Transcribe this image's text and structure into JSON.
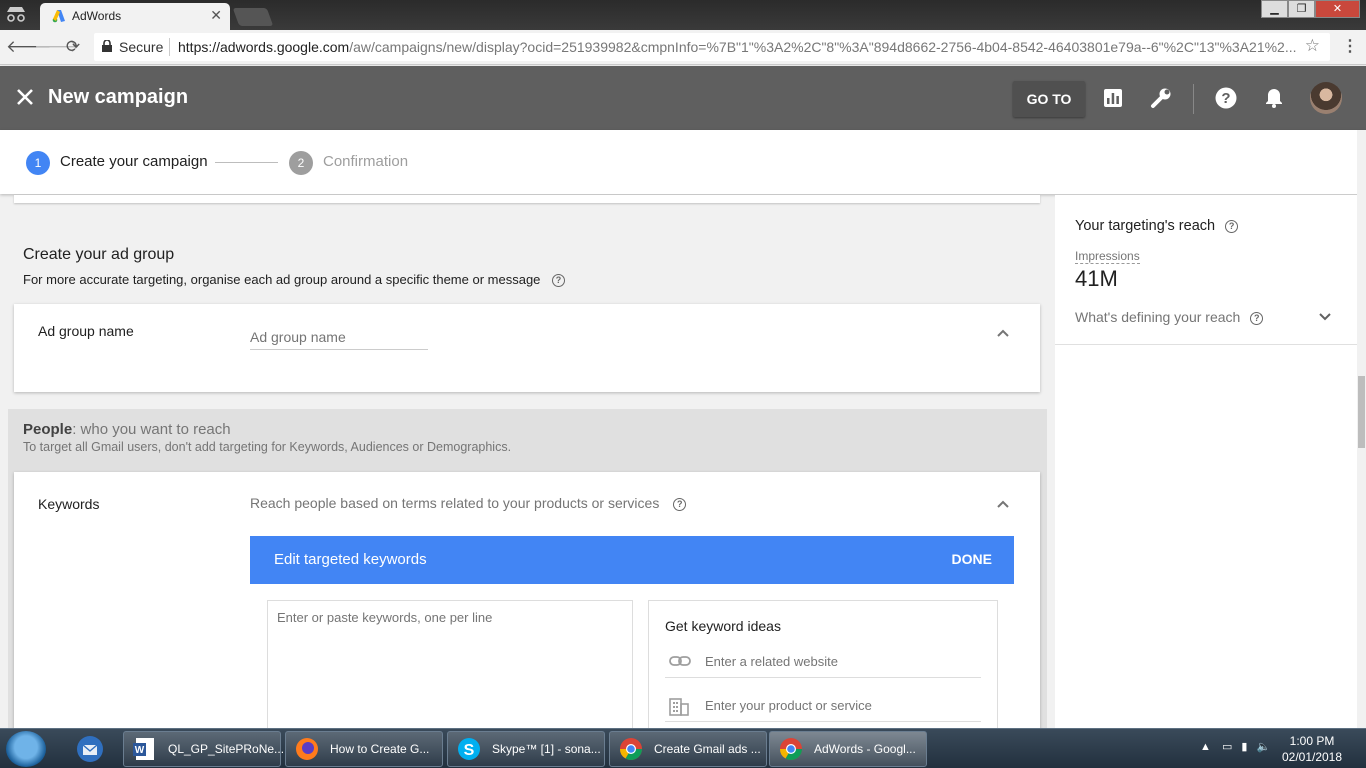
{
  "browser": {
    "tab_title": "AdWords",
    "secure_label": "Secure",
    "url_host": "https://adwords.google.com",
    "url_path": "/aw/campaigns/new/display?ocid=251939982&cmpnInfo=%7B\"1\"%3A2%2C\"8\"%3A\"894d8662-2756-4b04-8542-46403801e79a--6\"%2C\"13\"%3A21%2..."
  },
  "header": {
    "title": "New campaign",
    "goto_label": "GO TO"
  },
  "stepper": {
    "steps": [
      {
        "num": "1",
        "label": "Create your campaign"
      },
      {
        "num": "2",
        "label": "Confirmation"
      }
    ]
  },
  "ad_group": {
    "heading": "Create your ad group",
    "subtext": "For more accurate targeting, organise each ad group around a specific theme or message",
    "name_label": "Ad group name",
    "name_placeholder": "Ad group name"
  },
  "people": {
    "title_bold": "People",
    "title_rest": ": who you want to reach",
    "subtext": "To target all Gmail users, don't add targeting for Keywords, Audiences or Demographics."
  },
  "keywords": {
    "label": "Keywords",
    "description": "Reach people based on terms related to your products or services",
    "edit_title": "Edit targeted keywords",
    "done_label": "DONE",
    "textarea_placeholder": "Enter or paste keywords, one per line",
    "ideas_title": "Get keyword ideas",
    "website_placeholder": "Enter a related website",
    "product_placeholder": "Enter your product or service"
  },
  "sidebar": {
    "title": "Your targeting's reach",
    "impressions_label": "Impressions",
    "impressions_value": "41M",
    "defining_label": "What's defining your reach"
  },
  "taskbar": {
    "tasks": [
      {
        "label": "QL_GP_SitePRoNe..."
      },
      {
        "label": "How to Create G..."
      },
      {
        "label": "Skype™ [1] - sona..."
      },
      {
        "label": "Create Gmail ads ..."
      },
      {
        "label": "AdWords - Googl..."
      }
    ],
    "time": "1:00 PM",
    "date": "02/01/2018"
  },
  "colors": {
    "accent_blue": "#4285f4",
    "header_grey": "#5f5f5f"
  }
}
